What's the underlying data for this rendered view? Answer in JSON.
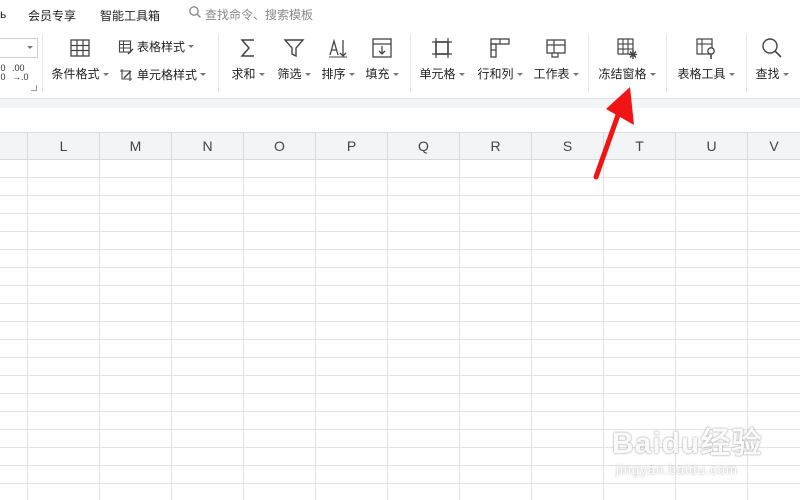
{
  "menubar": {
    "partial_item": "ь",
    "items": [
      "会员专享",
      "智能工具箱"
    ],
    "search_placeholder": "查找命令、搜索模板"
  },
  "ribbon": {
    "number_format": {
      "dropdown_value": "",
      "increase_decimal": ".00\n.0",
      "decrease_decimal": ".00\n→.0"
    },
    "conditional_format": "条件格式",
    "table_style": "表格样式",
    "cell_style": "单元格样式",
    "sum": "求和",
    "filter": "筛选",
    "sort": "排序",
    "fill": "填充",
    "cell": "单元格",
    "row_col": "行和列",
    "worksheet": "工作表",
    "freeze_panes": "冻结窗格",
    "table_tools": "表格工具",
    "find": "查找"
  },
  "grid": {
    "columns": [
      "L",
      "M",
      "N",
      "O",
      "P",
      "Q",
      "R",
      "S",
      "T",
      "U",
      "V"
    ]
  },
  "annotation": {
    "arrow_color": "#f01414"
  },
  "watermark": {
    "logo": "Baidu经验",
    "url": "jingyan.baidu.com"
  }
}
